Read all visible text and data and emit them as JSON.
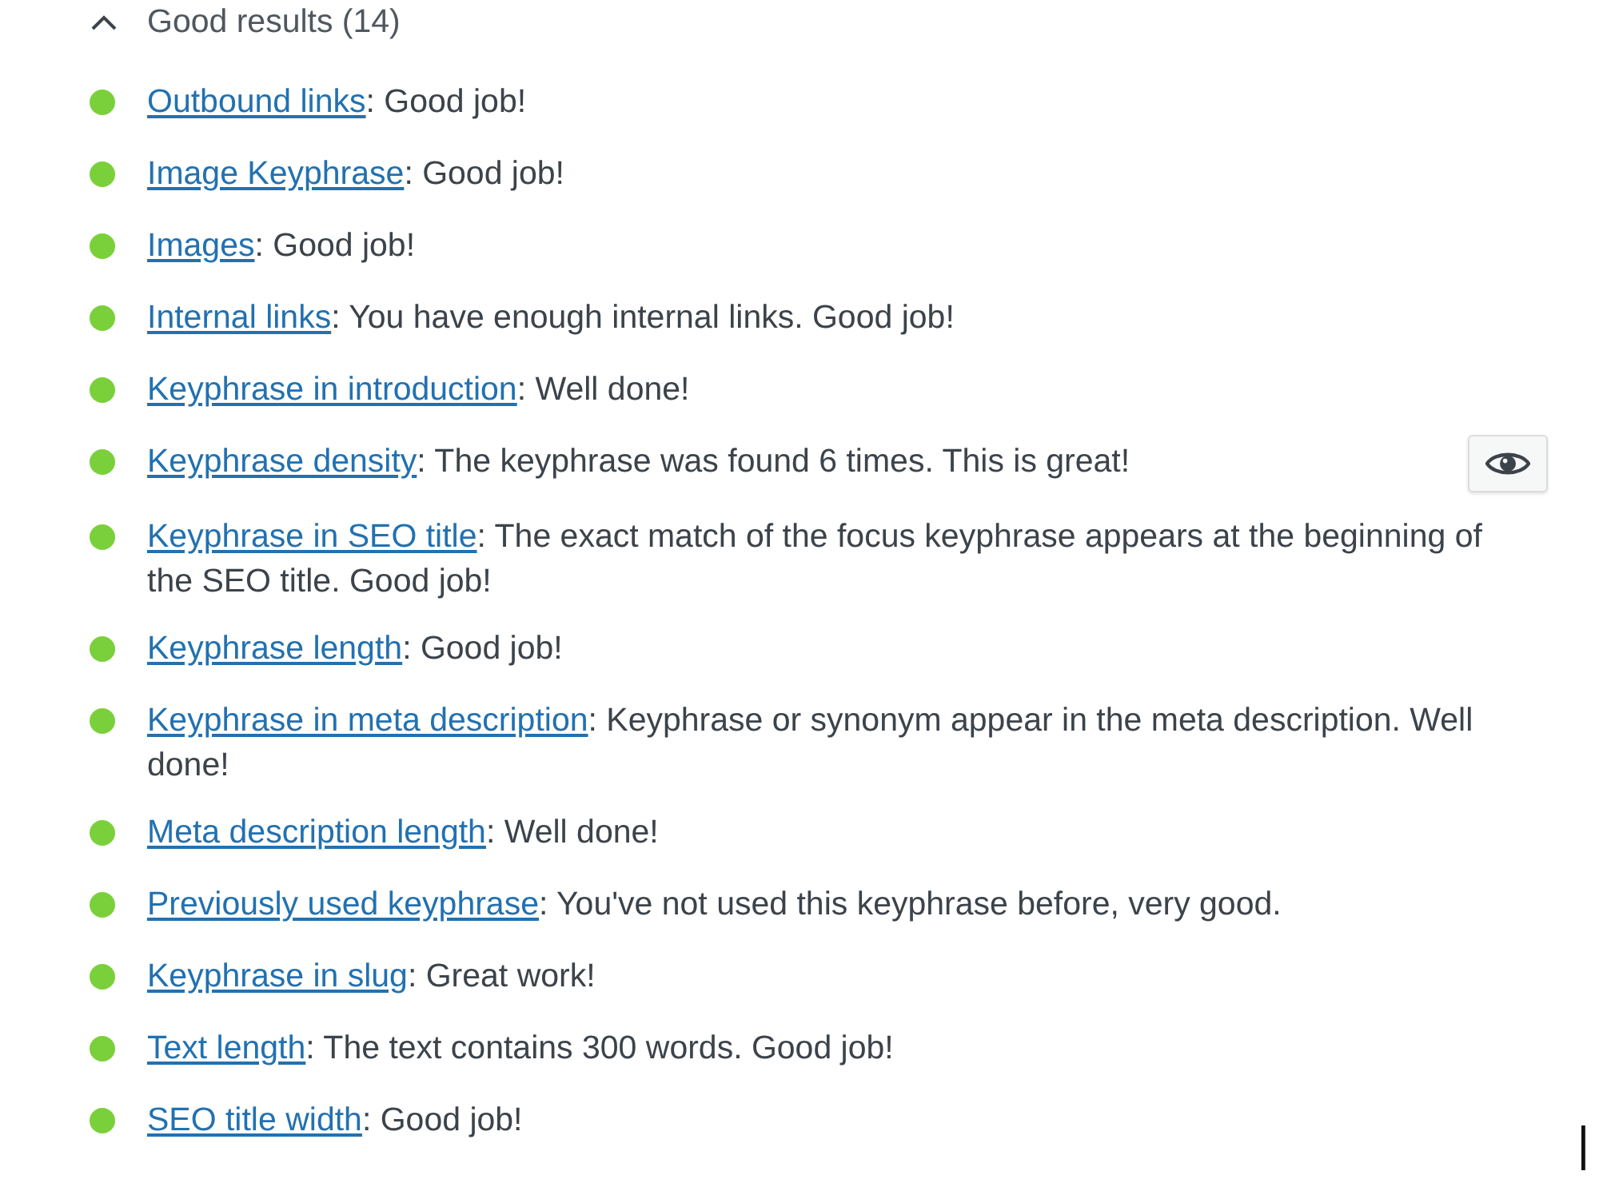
{
  "section": {
    "title": "Good results (14)",
    "expanded": true
  },
  "results": [
    {
      "link": "Outbound links",
      "text": ": Good job!",
      "color": "#7ad03a",
      "mark_button": false
    },
    {
      "link": "Image Keyphrase",
      "text": ": Good job!",
      "color": "#7ad03a",
      "mark_button": false
    },
    {
      "link": "Images",
      "text": ": Good job!",
      "color": "#7ad03a",
      "mark_button": false
    },
    {
      "link": "Internal links",
      "text": ": You have enough internal links. Good job!",
      "color": "#7ad03a",
      "mark_button": false
    },
    {
      "link": "Keyphrase in introduction",
      "text": ": Well done!",
      "color": "#7ad03a",
      "mark_button": false
    },
    {
      "link": "Keyphrase density",
      "text": ": The keyphrase was found 6 times. This is great!",
      "color": "#7ad03a",
      "mark_button": true
    },
    {
      "link": "Keyphrase in SEO title",
      "text": ": The exact match of the focus keyphrase appears at the beginning of the SEO title. Good job!",
      "color": "#7ad03a",
      "mark_button": false
    },
    {
      "link": "Keyphrase length",
      "text": ": Good job!",
      "color": "#7ad03a",
      "mark_button": false
    },
    {
      "link": "Keyphrase in meta description",
      "text": ": Keyphrase or synonym appear in the meta description. Well done!",
      "color": "#7ad03a",
      "mark_button": false
    },
    {
      "link": "Meta description length",
      "text": ": Well done!",
      "color": "#7ad03a",
      "mark_button": false
    },
    {
      "link": "Previously used keyphrase",
      "text": ": You've not used this keyphrase before, very good.",
      "color": "#7ad03a",
      "mark_button": false
    },
    {
      "link": "Keyphrase in slug",
      "text": ": Great work!",
      "color": "#7ad03a",
      "mark_button": false
    },
    {
      "link": "Text length",
      "text": ": The text contains 300 words. Good job!",
      "color": "#7ad03a",
      "mark_button": false
    },
    {
      "link": "SEO title width",
      "text": ": Good job!",
      "color": "#7ad03a",
      "mark_button": false
    }
  ]
}
